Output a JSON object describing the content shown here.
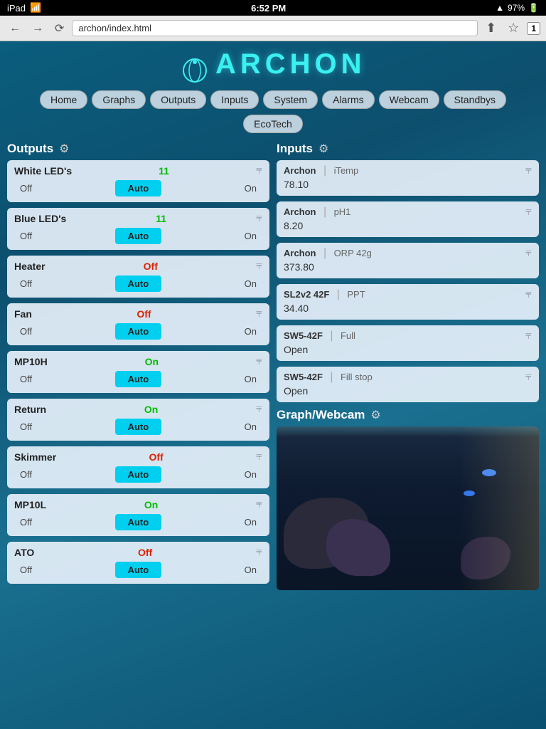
{
  "statusBar": {
    "left": "iPad",
    "wifi": "wifi",
    "time": "6:52 PM",
    "signal": "▲",
    "battery": "97%"
  },
  "browser": {
    "url": "archon/index.html",
    "tabCount": "1"
  },
  "logo": {
    "text": "ARCHON"
  },
  "nav": {
    "items": [
      "Home",
      "Graphs",
      "Outputs",
      "Inputs",
      "System",
      "Alarms",
      "Webcam",
      "Standbys"
    ],
    "row2": [
      "EcoTech"
    ]
  },
  "outputs": {
    "sectionTitle": "Outputs",
    "items": [
      {
        "name": "White LED's",
        "status": "11",
        "statusType": "green",
        "ctrlOff": "Off",
        "ctrlAuto": "Auto",
        "ctrlOn": "On"
      },
      {
        "name": "Blue LED's",
        "status": "11",
        "statusType": "green",
        "ctrlOff": "Off",
        "ctrlAuto": "Auto",
        "ctrlOn": "On"
      },
      {
        "name": "Heater",
        "status": "Off",
        "statusType": "red",
        "ctrlOff": "Off",
        "ctrlAuto": "Auto",
        "ctrlOn": "On"
      },
      {
        "name": "Fan",
        "status": "Off",
        "statusType": "red",
        "ctrlOff": "Off",
        "ctrlAuto": "Auto",
        "ctrlOn": "On"
      },
      {
        "name": "MP10H",
        "status": "On",
        "statusType": "green",
        "ctrlOff": "Off",
        "ctrlAuto": "Auto",
        "ctrlOn": "On"
      },
      {
        "name": "Return",
        "status": "On",
        "statusType": "green",
        "ctrlOff": "Off",
        "ctrlAuto": "Auto",
        "ctrlOn": "On"
      },
      {
        "name": "Skimmer",
        "status": "Off",
        "statusType": "red",
        "ctrlOff": "Off",
        "ctrlAuto": "Auto",
        "ctrlOn": "On"
      },
      {
        "name": "MP10L",
        "status": "On",
        "statusType": "green",
        "ctrlOff": "Off",
        "ctrlAuto": "Auto",
        "ctrlOn": "On"
      },
      {
        "name": "ATO",
        "status": "Off",
        "statusType": "red",
        "ctrlOff": "Off",
        "ctrlAuto": "Auto",
        "ctrlOn": "On"
      }
    ]
  },
  "inputs": {
    "sectionTitle": "Inputs",
    "items": [
      {
        "source": "Archon",
        "name": "iTemp",
        "value": "78.10"
      },
      {
        "source": "Archon",
        "name": "pH1",
        "value": "8.20"
      },
      {
        "source": "Archon",
        "name": "ORP 42g",
        "value": "373.80"
      },
      {
        "source": "SL2v2 42F",
        "name": "PPT",
        "value": "34.40"
      },
      {
        "source": "SW5-42F",
        "name": "Full",
        "value": "Open"
      },
      {
        "source": "SW5-42F",
        "name": "Fill stop",
        "value": "Open"
      }
    ]
  },
  "graphWebcam": {
    "title": "Graph/Webcam"
  }
}
